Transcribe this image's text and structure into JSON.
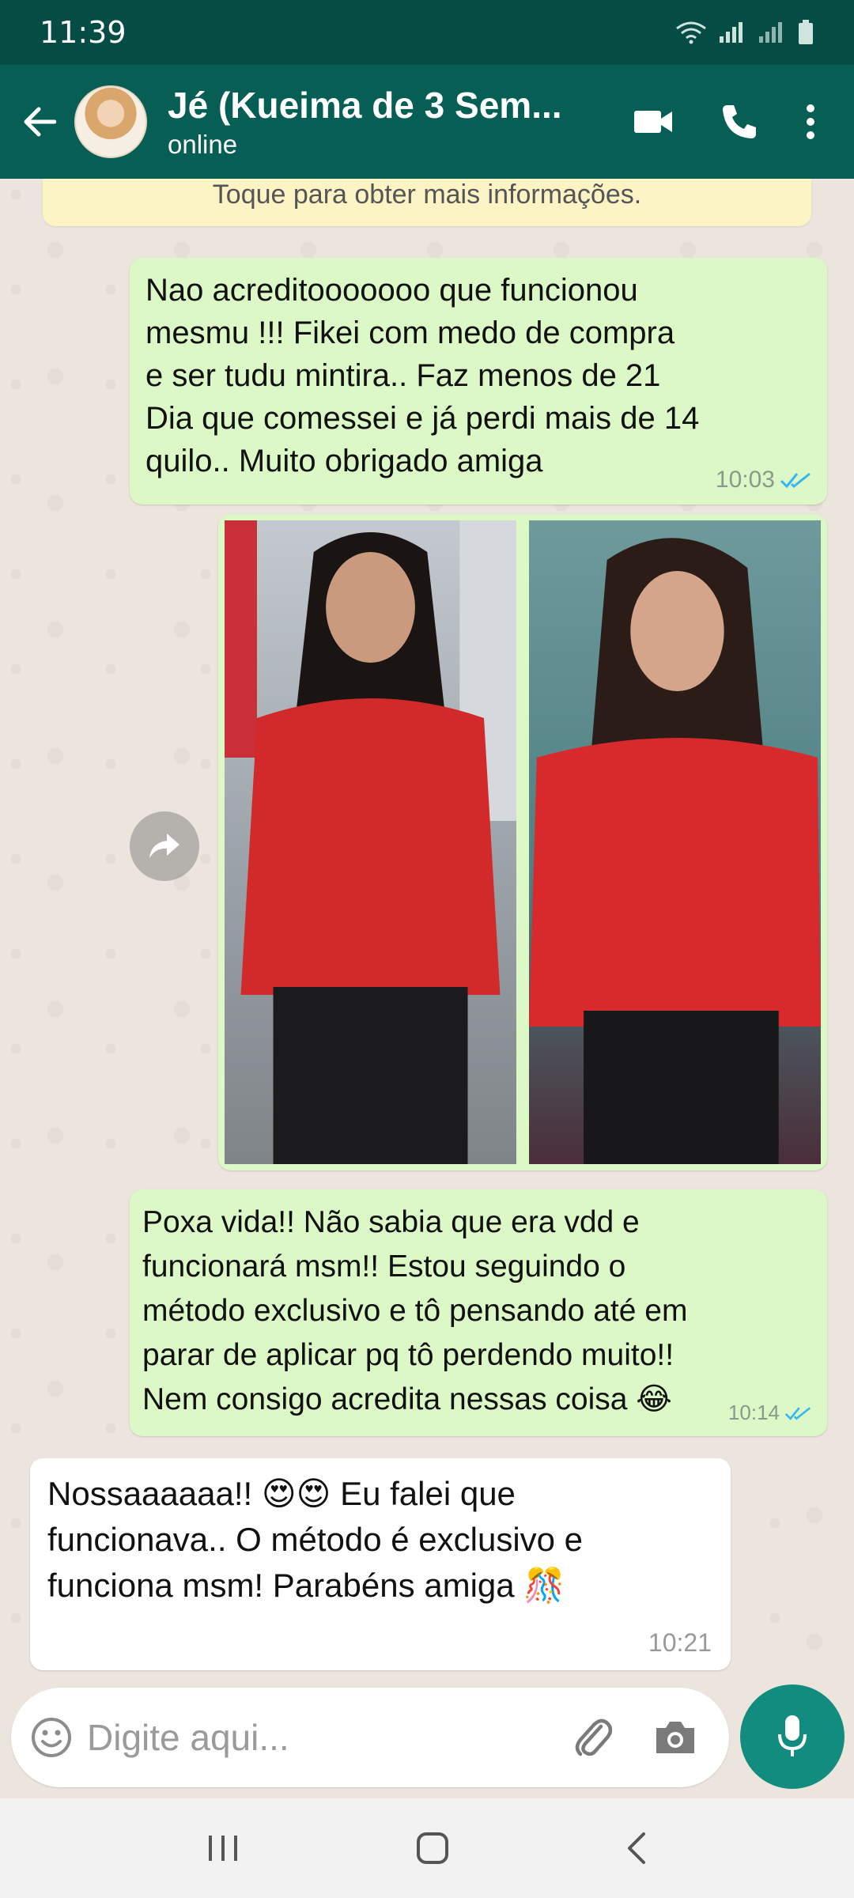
{
  "status_bar": {
    "time": "11:39"
  },
  "header": {
    "contact_name": "Jé (Kueima de 3 Sem...",
    "contact_status": "online"
  },
  "chat": {
    "info_banner": "Toque para obter mais informações.",
    "messages": [
      {
        "direction": "outgoing",
        "text": "Nao acreditooooooo que funcionou\nmesmu !!! Fikei com medo de compra\ne ser tudu mintira.. Faz menos de 21\nDia que comessei e já perdi mais de 14\nquilo.. Muito obrigado amiga",
        "time": "10:03",
        "read": true
      },
      {
        "direction": "outgoing",
        "type": "image",
        "description": "before-and-after photo collage"
      },
      {
        "direction": "outgoing",
        "text": "Poxa vida!! Não sabia que era vdd e\nfuncionará msm!! Estou seguindo o\nmétodo exclusivo e tô pensando até em\nparar de aplicar pq tô perdendo muito!!\nNem consigo acredita nessas coisa 😂",
        "time": "10:14",
        "read": true
      },
      {
        "direction": "incoming",
        "text": "Nossaaaaaa!! 😍😍 Eu falei que\nfuncionava.. O método é exclusivo e\nfunciona msm! Parabéns amiga 🎊",
        "time": "10:21"
      }
    ]
  },
  "input": {
    "placeholder": "Digite aqui..."
  },
  "colors": {
    "header": "#075e54",
    "status_bar": "#054d44",
    "outgoing_bubble": "#dcf8c6",
    "incoming_bubble": "#ffffff",
    "mic_button": "#128c7e",
    "read_ticks": "#34b7f1"
  }
}
